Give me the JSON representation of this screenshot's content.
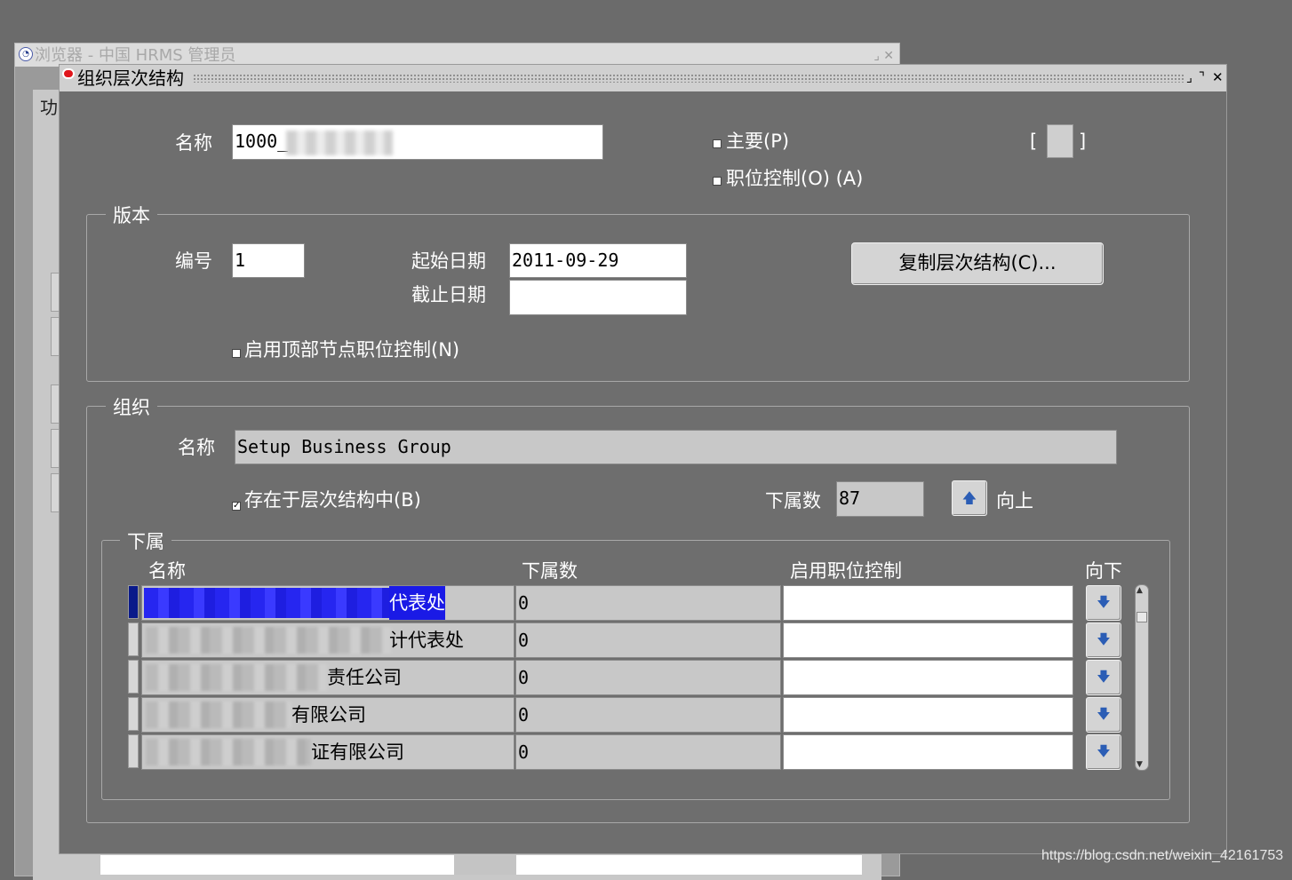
{
  "background_window": {
    "title": "浏览器 - 中国 HRMS 管理员",
    "panel_label": "功",
    "controls": "⌟ ✕"
  },
  "dialog": {
    "title": "组织层次结构",
    "controls": {
      "minimize": "⌟",
      "maximize": "⌝",
      "close": "✕"
    }
  },
  "header": {
    "name_label": "名称",
    "name_value": "1000_",
    "primary_label": "主要(P)",
    "position_control_label": "职位控制(O) (A)",
    "bracket_left": "[",
    "bracket_right": "]"
  },
  "version": {
    "group_title": "版本",
    "number_label": "编号",
    "number_value": "1",
    "start_date_label": "起始日期",
    "start_date_value": "2011-09-29",
    "end_date_label": "截止日期",
    "end_date_value": "",
    "copy_button": "复制层次结构(C)...",
    "enable_top_node_label": "启用顶部节点职位控制(N)"
  },
  "organization": {
    "group_title": "组织",
    "name_label": "名称",
    "name_value": "Setup Business Group",
    "exists_in_hierarchy_label": "存在于层次结构中(B)",
    "exists_in_hierarchy_checked": true,
    "subordinate_count_label": "下属数",
    "subordinate_count_value": "87",
    "up_button_icon": "arrow-up-icon",
    "up_label": "向上"
  },
  "subordinates": {
    "group_title": "下属",
    "columns": {
      "name": "名称",
      "count": "下属数",
      "enable_position_control": "启用职位控制",
      "down": "向下"
    },
    "rows": [
      {
        "name_suffix": "代表处",
        "count": "0",
        "position_control": "",
        "selected": true
      },
      {
        "name_suffix": "计代表处",
        "count": "0",
        "position_control": "",
        "selected": false
      },
      {
        "name_suffix": "责任公司",
        "count": "0",
        "position_control": "",
        "selected": false
      },
      {
        "name_suffix": "有限公司",
        "count": "0",
        "position_control": "",
        "selected": false
      },
      {
        "name_suffix": "证有限公司",
        "count": "0",
        "position_control": "",
        "selected": false
      }
    ]
  },
  "watermark": "https://blog.csdn.net/weixin_42161753",
  "colors": {
    "desktop": "#6b6b6b",
    "selection": "#1a1ae6",
    "arrow": "#2b5db5"
  }
}
